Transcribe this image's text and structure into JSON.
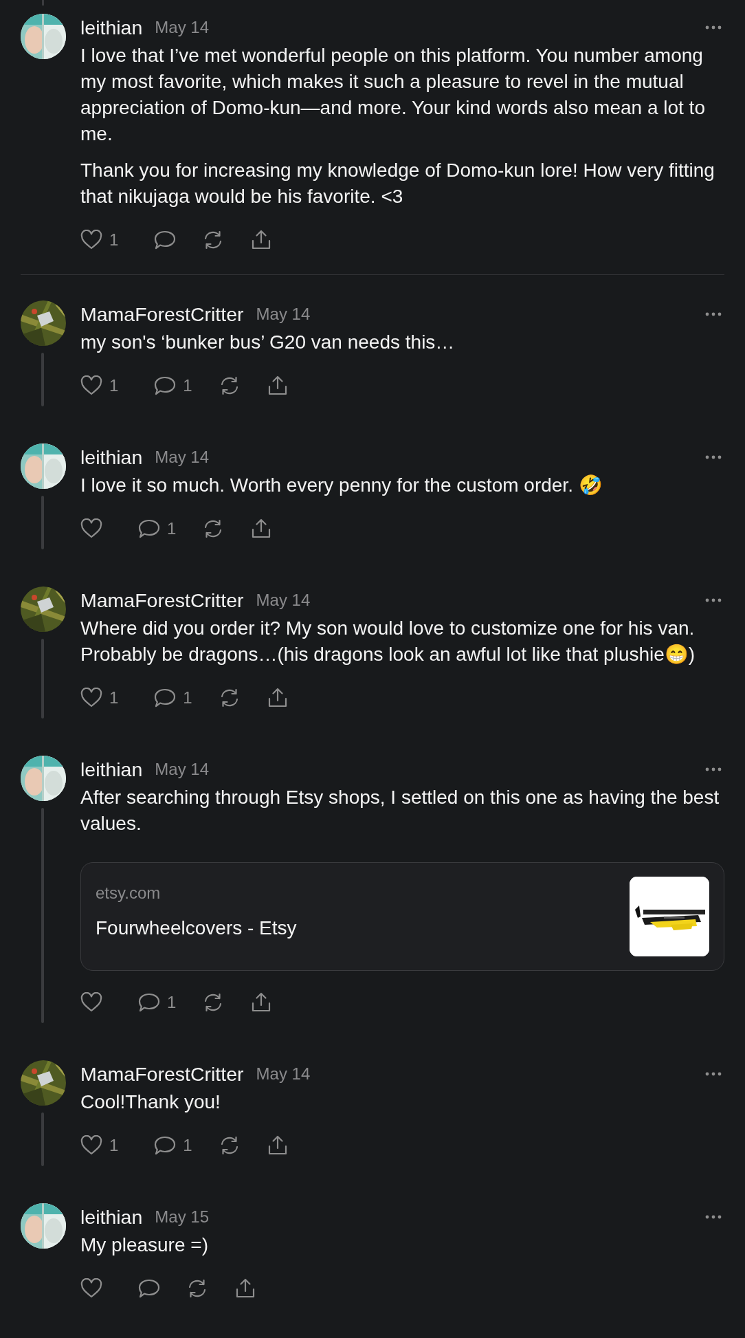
{
  "thread_stub_above": true,
  "posts": [
    {
      "author": "leithian",
      "date": "May 14",
      "paragraphs": [
        "I love that I’ve met wonderful people on this platform. You number among my most favorite, which makes it such a pleasure to revel in the mutual appreciation of Domo-kun—and more. Your kind words also mean a lot to me.",
        "Thank you for increasing my knowledge of Domo-kun lore! How very fitting that nikujaga would be his favorite. <3"
      ],
      "likes": "1",
      "thread_line": false,
      "divider_after": true
    },
    {
      "author": "MamaForestCritter",
      "date": "May 14",
      "paragraphs": [
        "my son's ‘bunker bus’ G20 van needs this…"
      ],
      "likes": "1",
      "replies": "1",
      "thread_line": true,
      "divider_after": false
    },
    {
      "author": "leithian",
      "date": "May 14",
      "paragraphs": [
        "I love it so much. Worth every penny for the custom order. 🤣"
      ],
      "replies": "1",
      "thread_line": true,
      "divider_after": false
    },
    {
      "author": "MamaForestCritter",
      "date": "May 14",
      "paragraphs": [
        "Where did you order it? My son would love to customize one for his van. Probably be dragons…(his dragons look an awful lot like that plushie😁)"
      ],
      "likes": "1",
      "replies": "1",
      "thread_line": true,
      "divider_after": false
    },
    {
      "author": "leithian",
      "date": "May 14",
      "paragraphs": [
        "After searching through Etsy shops, I settled on this one as having the best values."
      ],
      "link_card": {
        "domain": "etsy.com",
        "title": "Fourwheelcovers - Etsy"
      },
      "replies": "1",
      "thread_line": true,
      "divider_after": false
    },
    {
      "author": "MamaForestCritter",
      "date": "May 14",
      "paragraphs": [
        "Cool!Thank you!"
      ],
      "likes": "1",
      "replies": "1",
      "thread_line": true,
      "divider_after": false
    },
    {
      "author": "leithian",
      "date": "May 15",
      "paragraphs": [
        "My pleasure =)"
      ],
      "thread_line": false,
      "divider_after": false
    }
  ]
}
